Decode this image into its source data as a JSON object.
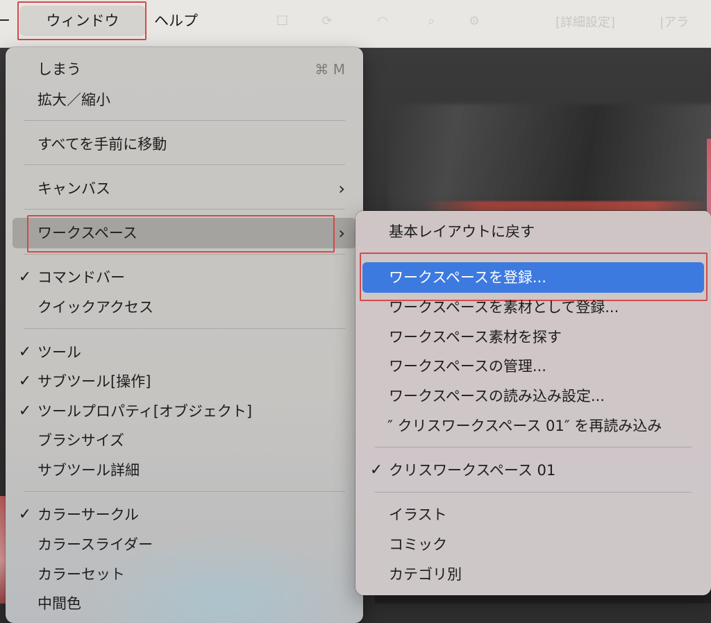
{
  "menubar": {
    "prev_label": "ー",
    "window_label": "ウィンドウ",
    "help_label": "ヘルプ",
    "faded_text_1": "□",
    "faded_text_2": "[詳細設定]",
    "faded_text_3": "|アラ",
    "status_icons": [
      "sync-icon",
      "wifi-icon",
      "search-icon",
      "control-center-icon"
    ]
  },
  "window_menu": {
    "items": [
      {
        "label": "しまう",
        "shortcut": "⌘ M"
      },
      {
        "label": "拡大／縮小"
      },
      {
        "label": "すべてを手前に移動"
      },
      {
        "label": "キャンバス",
        "submenu": true
      },
      {
        "label": "ワークスペース",
        "submenu": true,
        "highlighted": true
      },
      {
        "label": "コマンドバー",
        "checked": true
      },
      {
        "label": "クイックアクセス"
      },
      {
        "label": "ツール",
        "checked": true
      },
      {
        "label": "サブツール[操作]",
        "checked": true
      },
      {
        "label": "ツールプロパティ[オブジェクト]",
        "checked": true
      },
      {
        "label": "ブラシサイズ"
      },
      {
        "label": "サブツール詳細"
      },
      {
        "label": "カラーサークル",
        "checked": true
      },
      {
        "label": "カラースライダー"
      },
      {
        "label": "カラーセット"
      },
      {
        "label": "中間色"
      }
    ]
  },
  "workspace_menu": {
    "items": [
      {
        "label": "基本レイアウトに戻す"
      },
      {
        "label": "ワークスペースを登録...",
        "selected": true
      },
      {
        "label": "ワークスペースを素材として登録..."
      },
      {
        "label": "ワークスペース素材を探す"
      },
      {
        "label": "ワークスペースの管理..."
      },
      {
        "label": "ワークスペースの読み込み設定..."
      },
      {
        "label": "″ クリスワークスペース 01″ を再読み込み"
      },
      {
        "label": "クリスワークスペース 01",
        "checked": true
      },
      {
        "label": "イラスト"
      },
      {
        "label": "コミック"
      },
      {
        "label": "カテゴリ別"
      }
    ]
  },
  "glyphs": {
    "check": "✓",
    "arrow": "›"
  },
  "colors": {
    "selection": "#3d7ae0",
    "highlight_frame": "#d24a4a",
    "menu_hover": "#a5a3a0"
  }
}
